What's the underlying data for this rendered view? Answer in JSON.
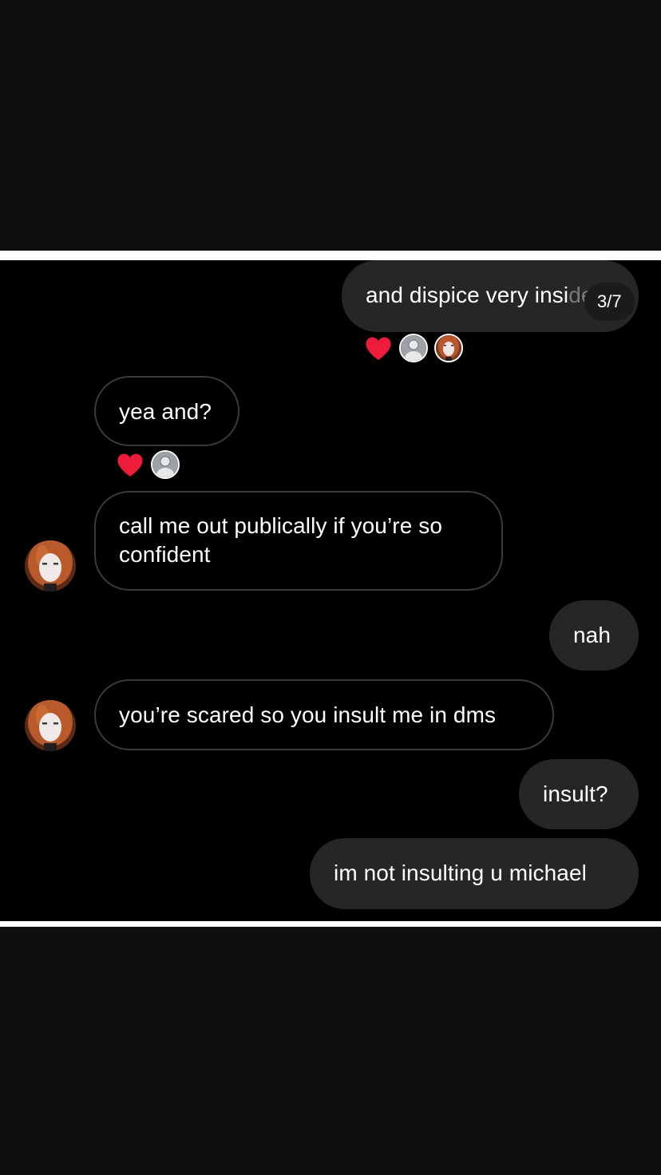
{
  "counter": "3/7",
  "messages": [
    {
      "text": "and dispice very insi",
      "overflow": "de"
    },
    {
      "text": "yea and?"
    },
    {
      "text": "call me out publically if you’re so confident"
    },
    {
      "text": "nah"
    },
    {
      "text": "you’re scared so you insult me in dms"
    },
    {
      "text": "insult?"
    },
    {
      "text": "im not insulting u michael"
    }
  ],
  "icons": {
    "heart": "heart-reaction-icon",
    "default_avatar": "default-avatar-icon",
    "profile_avatar": "profile-avatar"
  },
  "colors": {
    "background": "#000000",
    "sent_bubble": "#262626",
    "received_border": "#3a3a3a",
    "heart": "#ed1c3a",
    "separator": "#ffffff"
  }
}
